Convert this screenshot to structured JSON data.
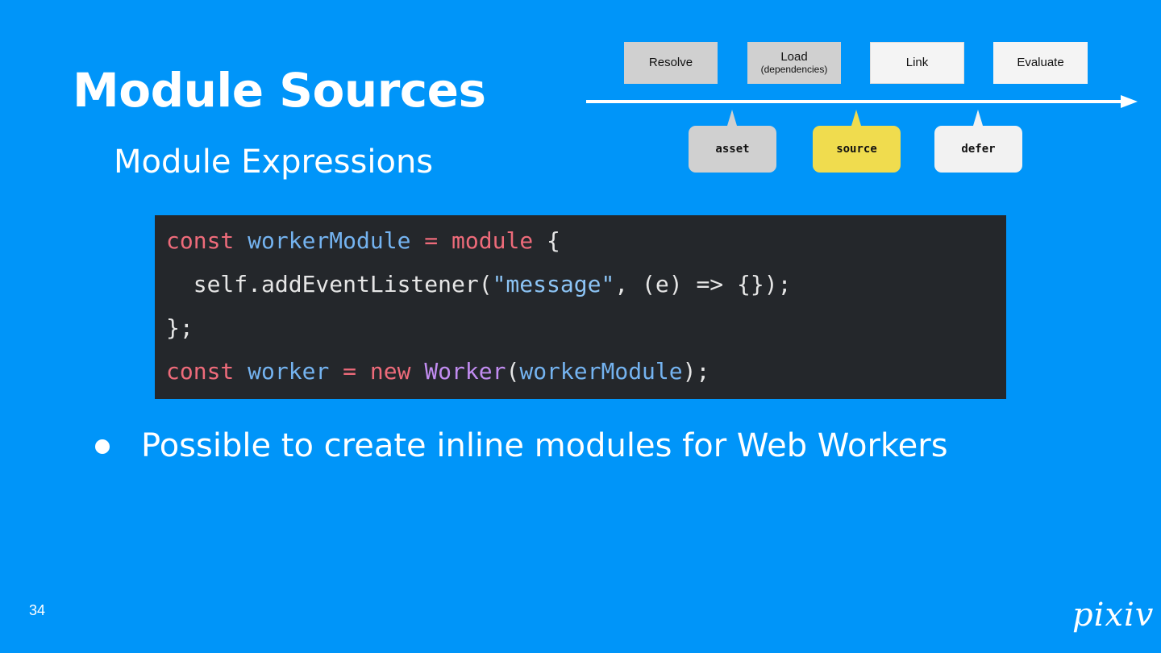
{
  "slide": {
    "title": "Module Sources",
    "subtitle": "Module Expressions",
    "page_number": "34",
    "logo": "pixiv",
    "bullet": "Possible to create inline modules for Web Workers"
  },
  "pipeline": {
    "stages": [
      {
        "label": "Resolve",
        "sub": "",
        "color": "#d0d0d0"
      },
      {
        "label": "Load",
        "sub": "(dependencies)",
        "color": "#d0d0d0"
      },
      {
        "label": "Link",
        "sub": "",
        "color": "#f4f4f4"
      },
      {
        "label": "Evaluate",
        "sub": "",
        "color": "#f4f4f4"
      }
    ],
    "phases": [
      {
        "label": "asset",
        "color": "#d0d0d0"
      },
      {
        "label": "source",
        "color": "#f0dc4e"
      },
      {
        "label": "defer",
        "color": "#f2f2f2"
      }
    ]
  },
  "code": {
    "lines": [
      [
        {
          "t": "const ",
          "c": "kw"
        },
        {
          "t": "workerModule",
          "c": "id"
        },
        {
          "t": " = ",
          "c": "kw"
        },
        {
          "t": "module",
          "c": "kw"
        },
        {
          "t": " {",
          "c": ""
        }
      ],
      [
        {
          "t": "  self.addEventListener(",
          "c": ""
        },
        {
          "t": "\"message\"",
          "c": "str"
        },
        {
          "t": ", (e) => {});",
          "c": ""
        }
      ],
      [
        {
          "t": "};",
          "c": ""
        }
      ],
      [
        {
          "t": "const ",
          "c": "kw"
        },
        {
          "t": "worker",
          "c": "id"
        },
        {
          "t": " = ",
          "c": "kw"
        },
        {
          "t": "new ",
          "c": "kw"
        },
        {
          "t": "Worker",
          "c": "cls"
        },
        {
          "t": "(",
          "c": ""
        },
        {
          "t": "workerModule",
          "c": "id"
        },
        {
          "t": ");",
          "c": ""
        }
      ]
    ]
  }
}
